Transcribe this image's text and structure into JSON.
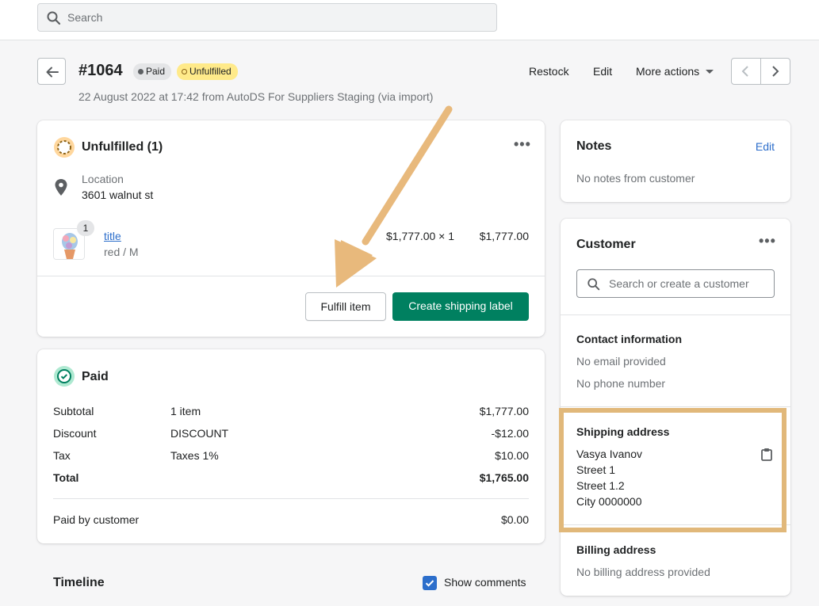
{
  "search": {
    "placeholder": "Search"
  },
  "order": {
    "number": "#1064",
    "badge_paid": "Paid",
    "badge_unfulfilled": "Unfulfilled",
    "subtitle": "22 August 2022 at 17:42 from AutoDS For Suppliers Staging (via import)"
  },
  "header_actions": {
    "restock": "Restock",
    "edit": "Edit",
    "more": "More actions"
  },
  "fulfillment": {
    "title": "Unfulfilled (1)",
    "location_label": "Location",
    "location_value": "3601 walnut st",
    "item": {
      "quantity": "1",
      "title": "title",
      "variant": "red / M",
      "unit": "$1,777.00 × 1",
      "total": "$1,777.00"
    },
    "fulfill_button": "Fulfill item",
    "shipping_button": "Create shipping label"
  },
  "payment": {
    "title": "Paid",
    "rows": [
      {
        "label": "Subtotal",
        "detail": "1 item",
        "amount": "$1,777.00"
      },
      {
        "label": "Discount",
        "detail": "DISCOUNT",
        "amount": "-$12.00"
      },
      {
        "label": "Tax",
        "detail": "Taxes 1%",
        "amount": "$10.00"
      },
      {
        "label": "Total",
        "detail": "",
        "amount": "$1,765.00"
      }
    ],
    "paid_by_label": "Paid by customer",
    "paid_by_amount": "$0.00"
  },
  "timeline": {
    "title": "Timeline",
    "show_comments": "Show comments",
    "show_comments_checked": true
  },
  "notes": {
    "title": "Notes",
    "edit": "Edit",
    "empty": "No notes from customer"
  },
  "customer": {
    "title": "Customer",
    "search_placeholder": "Search or create a customer",
    "contact_title": "Contact information",
    "no_email": "No email provided",
    "no_phone": "No phone number",
    "shipping_title": "Shipping address",
    "shipping_lines": [
      "Vasya Ivanov",
      "Street 1",
      "Street 1.2",
      "City 0000000"
    ],
    "billing_title": "Billing address",
    "billing_empty": "No billing address provided"
  },
  "colors": {
    "primary": "#008060",
    "link": "#2c6ecb",
    "annotation": "#e1b87a"
  }
}
